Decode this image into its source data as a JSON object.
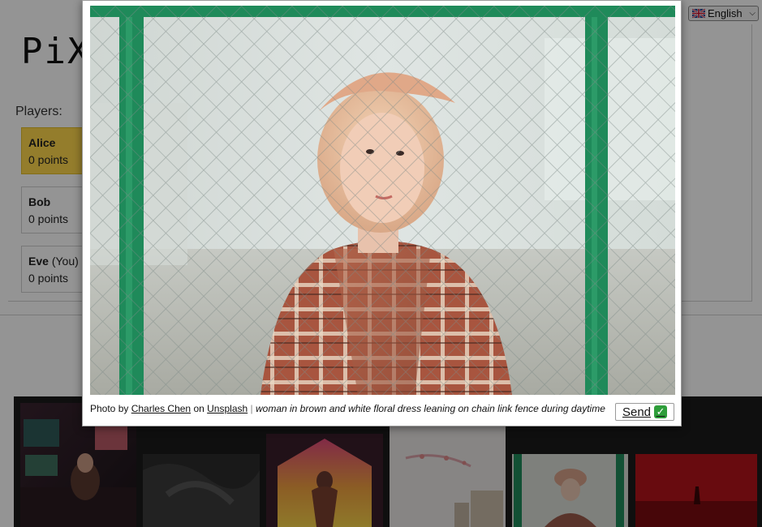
{
  "language": {
    "selected": "English",
    "icon": "uk-flag-icon"
  },
  "logo": {
    "text": "PiXT"
  },
  "players": {
    "label": "Players:",
    "list": [
      {
        "name": "Alice",
        "suffix": "",
        "points": "0 points",
        "active": true
      },
      {
        "name": "Bob",
        "suffix": "",
        "points": "0 points",
        "active": false
      },
      {
        "name": "Eve",
        "suffix": "(You)",
        "points": "0 points",
        "active": false
      }
    ]
  },
  "modal": {
    "credit_prefix": "Photo by",
    "photographer": "Charles Chen",
    "on": "on",
    "source": "Unsplash",
    "pipe": "|",
    "caption": "woman in brown and white floral dress leaning on chain link fence during daytime",
    "send_label": "Send",
    "send_icon": "check-mark-icon"
  },
  "colors": {
    "active_player": "#ffd84d",
    "fence_green": "#1f8a5a",
    "send_check": "#2e9e3a"
  }
}
